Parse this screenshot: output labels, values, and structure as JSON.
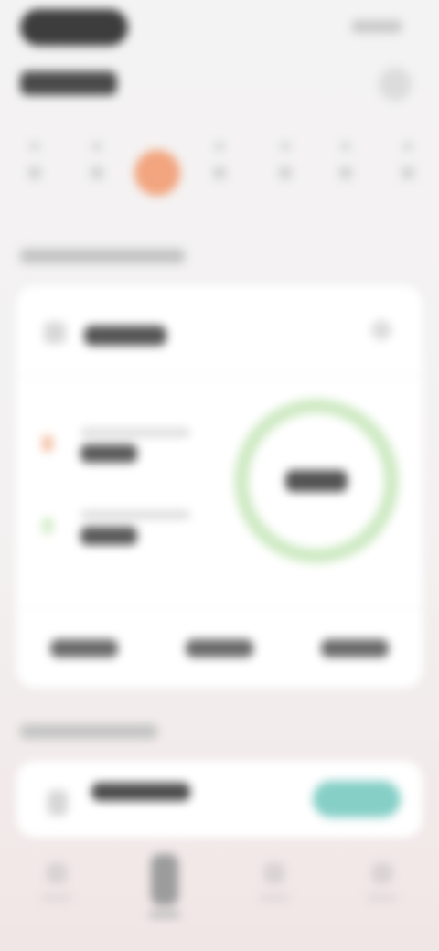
{
  "header": {
    "title": "",
    "meta": ""
  },
  "week": {
    "days": [
      {
        "dow": "",
        "num": "",
        "active": false
      },
      {
        "dow": "",
        "num": "",
        "active": false
      },
      {
        "dow": "",
        "num": "",
        "active": true
      },
      {
        "dow": "",
        "num": "",
        "active": false
      },
      {
        "dow": "",
        "num": "",
        "active": false
      },
      {
        "dow": "",
        "num": "",
        "active": false
      },
      {
        "dow": "",
        "num": "",
        "active": false
      }
    ]
  },
  "summary": {
    "section_title": "",
    "card_title": "",
    "metrics": [
      {
        "label": "",
        "value": "",
        "color": "#f2a57f"
      },
      {
        "label": "",
        "value": "",
        "color": "#bfe3b3"
      }
    ],
    "ring_value": "",
    "stats": [
      "",
      "",
      ""
    ]
  },
  "activity": {
    "section_title": "",
    "title": "",
    "button_label": ""
  },
  "colors": {
    "accent": "#f2a57f",
    "ring": "#cfeac4",
    "button": "#86cfc7"
  },
  "nav": {
    "items": [
      {
        "label": "",
        "icon": "home-icon",
        "active": false
      },
      {
        "label": "",
        "icon": "calendar-icon",
        "active": true
      },
      {
        "label": "",
        "icon": "chart-icon",
        "active": false
      },
      {
        "label": "",
        "icon": "profile-icon",
        "active": false
      }
    ]
  }
}
